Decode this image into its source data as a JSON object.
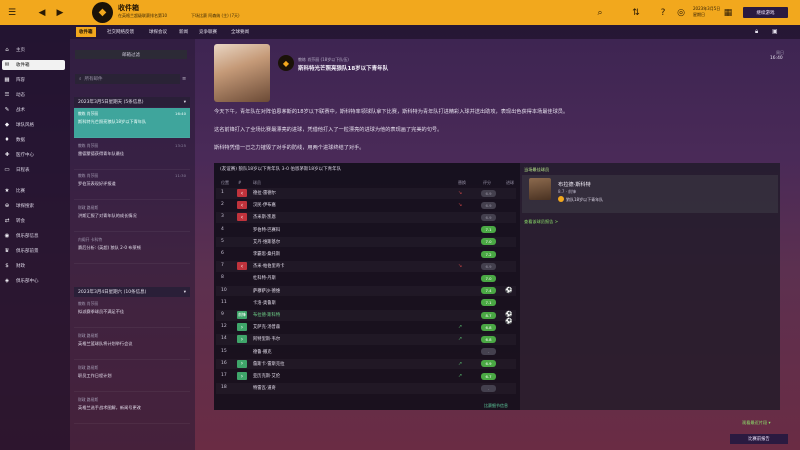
{
  "topbar": {
    "title": "收件箱",
    "crumb1": "在英格兰超级联赛排名第10",
    "crumb2": "下场比赛 阿森纳 (主) (7天)",
    "date": "2023年3月5日",
    "weekday": "星期日",
    "continue_label": "继续游戏"
  },
  "tabs": [
    "收件箱",
    "社交网络反馈",
    "球探会议",
    "新闻",
    "竞争联赛",
    "全球要闻"
  ],
  "sidebar": {
    "items": [
      {
        "icon": "⌂",
        "label": "主页"
      },
      {
        "icon": "✉",
        "label": "收件箱"
      },
      {
        "icon": "▦",
        "label": "阵容"
      },
      {
        "icon": "☰",
        "label": "动态"
      },
      {
        "icon": "✎",
        "label": "战术"
      },
      {
        "icon": "◆",
        "label": "球队风格"
      },
      {
        "icon": "♦",
        "label": "数据"
      },
      {
        "icon": "✚",
        "label": "医疗中心"
      },
      {
        "icon": "▭",
        "label": "日程表"
      },
      {
        "icon": "★",
        "label": "比赛"
      },
      {
        "icon": "⊕",
        "label": "球探搜索"
      },
      {
        "icon": "⇄",
        "label": "转会"
      },
      {
        "icon": "◉",
        "label": "俱乐部信息"
      },
      {
        "icon": "♛",
        "label": "俱乐部前景"
      },
      {
        "icon": "$",
        "label": "财政"
      },
      {
        "icon": "◈",
        "label": "俱乐部中心"
      }
    ]
  },
  "list": {
    "filter_label": "邮箱过滤",
    "search_placeholder": "所有邮件",
    "groups": [
      {
        "label": "2023年3月5日星期天 (5条信息)"
      },
      {
        "label": "2023年3月4日星期六 (10条信息)"
      }
    ],
    "messages": [
      {
        "from": "教练 肖莎丽",
        "subject": "斯科特光芒照亮狼队18岁以下青年队",
        "time": "16:40"
      },
      {
        "from": "教练 肖莎丽",
        "subject": "雷德蒙德获得青年队最佳",
        "time": "13:25"
      },
      {
        "from": "教练 肖莎丽",
        "subject": "罗伯茨表现好评报道",
        "time": "11:30"
      },
      {
        "from": "财政 路易斯",
        "subject": "洪斯汇报了对青年队的成长情况",
        "time": ""
      },
      {
        "from": "内阁开 卡科特",
        "subject": "赛后分析: (英超) 狼队 2-0 布莱顿",
        "time": ""
      },
      {
        "from": "教练 肖莎丽",
        "subject": "斯科特光芒照亮狼队18岁以下青年队中的亮点",
        "time": ""
      },
      {
        "from": "教练 肖莎丽",
        "subject": "拟派赛季球员不满足不佳",
        "time": ""
      },
      {
        "from": "财政 路易斯",
        "subject": "英格兰篮球队将计划举行会议",
        "time": ""
      },
      {
        "from": "财政 路易斯",
        "subject": "职员工作日程计划",
        "time": ""
      },
      {
        "from": "财政 路易斯",
        "subject": "英格兰选手战术图解，新闻号更改",
        "time": ""
      }
    ]
  },
  "message": {
    "from": "教练 肖莎丽 (18岁以下队伍)",
    "subject": "斯科特光芒照亮狼队18岁以下青年队",
    "paragraphs": [
      "今天下午，青年队在对阵伯恩茅斯的18岁以下联赛中，斯科特率领球队拿下比赛，斯科特为青年队打进精彩入球并送出助攻，表现出色获得本场最佳球员。",
      "这名前锋打入了全场比赛最漂亮的进球，凭借他打入了一粒漂亮的进球为他的表现画了完美的句号。",
      "斯科特凭借一己之力摧毁了对手的防线，用两个进球终结了对手。"
    ]
  },
  "table": {
    "title": "(友谊赛) 狼队18岁以下青年队 3-0 伯恩茅斯18岁以下青年队",
    "headers": [
      "位置",
      "#",
      "球员",
      "替换",
      "评分",
      "进球"
    ],
    "rows": [
      {
        "n": "1",
        "mark": "out",
        "name": "德拉·雷德尔",
        "sub": "red",
        "rating": "6.9",
        "rclass": "dim",
        "ball": ""
      },
      {
        "n": "2",
        "mark": "out",
        "name": "汉民·伊布嘉",
        "sub": "red",
        "rating": "6.9",
        "rclass": "dim",
        "ball": ""
      },
      {
        "n": "3",
        "mark": "out",
        "name": "杰米斯·凯恩",
        "sub": "",
        "rating": "6.9",
        "rclass": "dim",
        "ball": ""
      },
      {
        "n": "4",
        "mark": "",
        "name": "罗伯特·巴赛科",
        "sub": "",
        "rating": "7.1",
        "rclass": "g",
        "ball": ""
      },
      {
        "n": "5",
        "mark": "",
        "name": "艾丹·维斯基尔",
        "sub": "",
        "rating": "7.0",
        "rclass": "g",
        "ball": ""
      },
      {
        "n": "6",
        "mark": "",
        "name": "李霸思·桑托斯",
        "sub": "",
        "rating": "7.2",
        "rclass": "g",
        "ball": ""
      },
      {
        "n": "7",
        "mark": "out",
        "name": "杰米·帕伯里奇卡",
        "sub": "red",
        "rating": "6.9",
        "rclass": "dim",
        "ball": ""
      },
      {
        "n": "8",
        "mark": "",
        "name": "杜科特·丹斯",
        "sub": "",
        "rating": "7.0",
        "rclass": "g",
        "ball": ""
      },
      {
        "n": "10",
        "mark": "",
        "name": "萨穆萨沙·德维",
        "sub": "",
        "rating": "7.4",
        "rclass": "g",
        "ball": "⚽"
      },
      {
        "n": "11",
        "mark": "",
        "name": "卡洛·奥鲁斯",
        "sub": "",
        "rating": "7.1",
        "rclass": "g",
        "ball": ""
      },
      {
        "n": "9",
        "mark": "st",
        "name": "布拉德·斯科特",
        "sub": "",
        "rating": "8.7",
        "rclass": "g",
        "ball": "⚽⚽",
        "hl": true
      },
      {
        "n": "12",
        "mark": "in",
        "name": "艾萨克·汤普森",
        "sub": "green",
        "rating": "6.8",
        "rclass": "g",
        "ball": ""
      },
      {
        "n": "14",
        "mark": "in",
        "name": "阿特里斯·韦尔",
        "sub": "green",
        "rating": "6.8",
        "rclass": "g",
        "ball": ""
      },
      {
        "n": "15",
        "mark": "",
        "name": "德鲁·撒克",
        "sub": "",
        "rating": "-",
        "rclass": "dim",
        "ball": ""
      },
      {
        "n": "16",
        "mark": "in",
        "name": "詹斯卡·雷斯克拉",
        "sub": "green",
        "rating": "6.9",
        "rclass": "g",
        "ball": ""
      },
      {
        "n": "17",
        "mark": "in",
        "name": "亚历克斯·艾伦",
        "sub": "green",
        "rating": "6.7",
        "rclass": "g",
        "ball": ""
      },
      {
        "n": "18",
        "mark": "",
        "name": "特雷瓦·道奇",
        "sub": "",
        "rating": "-",
        "rclass": "dim",
        "ball": ""
      }
    ],
    "link": "比赛细节信息"
  },
  "potm": {
    "heading": "当场最佳球员",
    "name": "布拉德·斯科特",
    "rating": "8.7 · 前锋",
    "club": "狼队18岁以下青年队",
    "next_link": "查看该球员报告 >"
  },
  "clock": {
    "label": "16:40",
    "day": "周日"
  },
  "bottom": {
    "next_match": "观看最近片段 ▾",
    "button": "比赛前报告"
  }
}
